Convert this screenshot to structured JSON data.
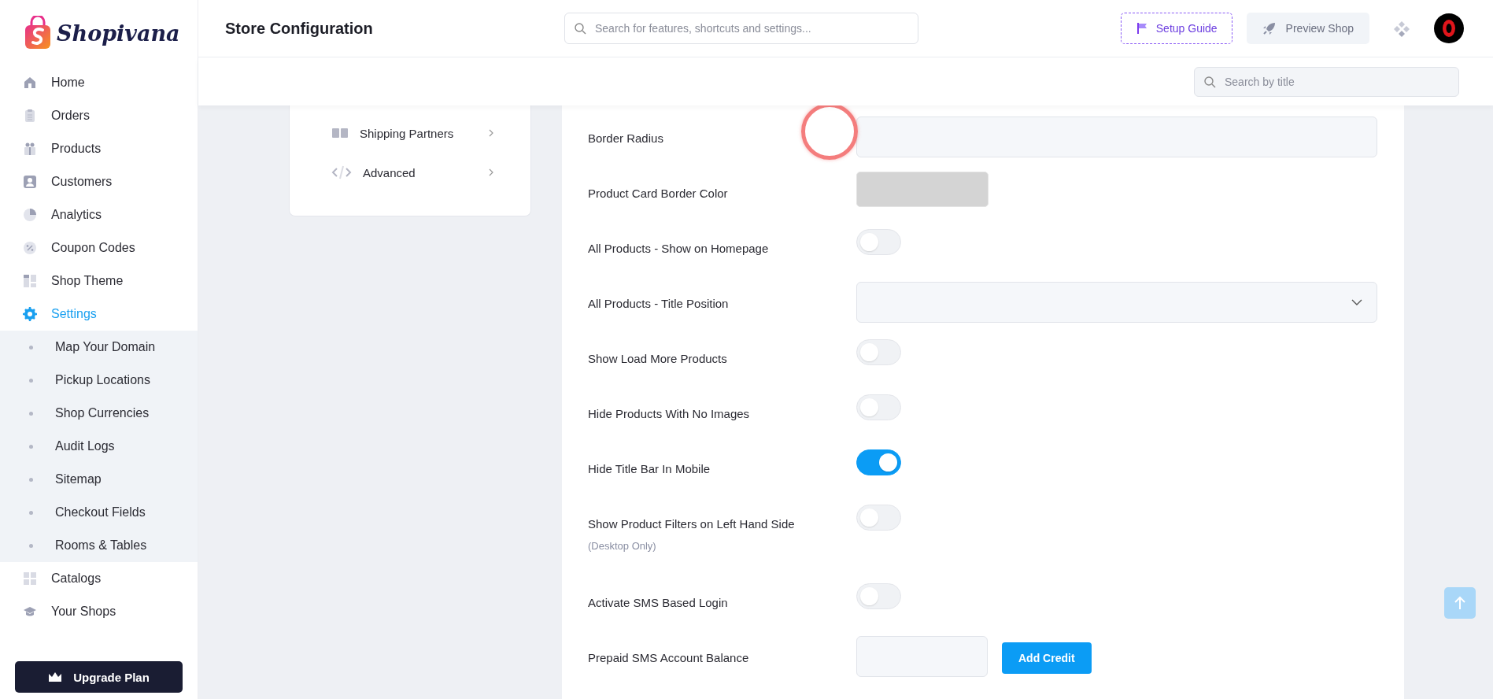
{
  "logo": {
    "text": "Shopivana"
  },
  "sidebar": {
    "items": [
      {
        "label": "Home",
        "selected": false
      },
      {
        "label": "Orders",
        "selected": false
      },
      {
        "label": "Products",
        "selected": false
      },
      {
        "label": "Customers",
        "selected": false
      },
      {
        "label": "Analytics",
        "selected": false
      },
      {
        "label": "Coupon Codes",
        "selected": false
      },
      {
        "label": "Shop Theme",
        "selected": false
      },
      {
        "label": "Settings",
        "selected": true,
        "expanded": true,
        "children": [
          {
            "label": "Map Your Domain",
            "selected": false
          },
          {
            "label": "Pickup Locations",
            "selected": false
          },
          {
            "label": "Shop Currencies",
            "selected": false
          },
          {
            "label": "Audit Logs",
            "selected": false
          },
          {
            "label": "Sitemap",
            "selected": false
          },
          {
            "label": "Checkout Fields",
            "selected": false
          },
          {
            "label": "Rooms & Tables",
            "selected": false
          }
        ]
      },
      {
        "label": "Catalogs",
        "selected": false
      },
      {
        "label": "Your Shops",
        "selected": false
      }
    ],
    "upgrade_button": "Upgrade Plan"
  },
  "header": {
    "title": "Store Configuration",
    "search": {
      "placeholder": "Search for features, shortcuts and settings..."
    },
    "setup_guide": "Setup Guide",
    "preview_shop": "Preview Shop"
  },
  "subbar": {
    "search": {
      "placeholder": "Search by title"
    }
  },
  "settings_menu": {
    "items": [
      {
        "label": "Shipping Partners"
      },
      {
        "label": "Advanced"
      }
    ]
  },
  "form": {
    "fields": [
      {
        "kind": "text",
        "label": "Border Radius"
      },
      {
        "kind": "color",
        "label": "Product Card Border Color"
      },
      {
        "kind": "toggle",
        "label": "All Products - Show on Homepage",
        "on": false
      },
      {
        "kind": "select",
        "label": "All Products - Title Position"
      },
      {
        "kind": "toggle",
        "label": "Show Load More Products",
        "on": false
      },
      {
        "kind": "toggle",
        "label": "Hide Products With No Images",
        "on": false
      },
      {
        "kind": "toggle",
        "label": "Hide Title Bar In Mobile",
        "on": true
      },
      {
        "kind": "toggle",
        "label": "Show Product Filters on Left Hand Side",
        "note": "(Desktop Only)",
        "on": false
      },
      {
        "kind": "toggle",
        "label": "Activate SMS Based Login",
        "on": false
      },
      {
        "kind": "balance",
        "label": "Prepaid SMS Account Balance",
        "button": "Add Credit"
      }
    ]
  }
}
